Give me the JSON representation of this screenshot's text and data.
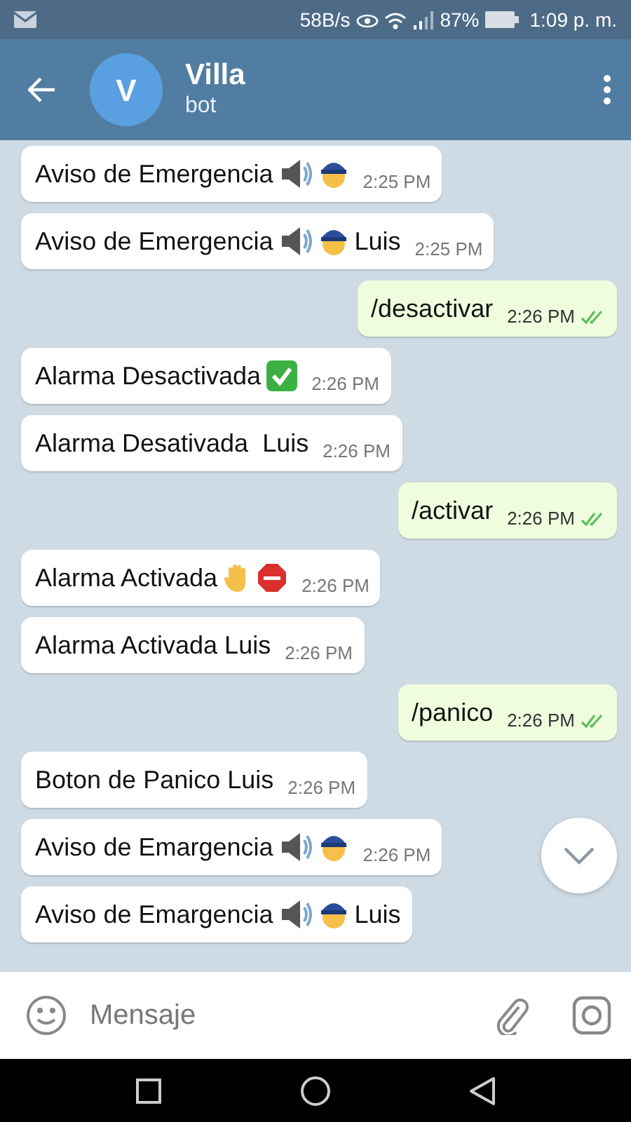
{
  "status_bar": {
    "speed": "58B/s",
    "battery": "87%",
    "time": "1:09 p. m."
  },
  "header": {
    "avatar": "V",
    "title": "Villa",
    "subtitle": "bot"
  },
  "messages": [
    {
      "outgoing": false,
      "time": "2:25 PM",
      "parts": [
        {
          "kind": "text",
          "text": "Aviso de Emergencia"
        },
        {
          "kind": "speaker"
        },
        {
          "kind": "officer"
        }
      ]
    },
    {
      "outgoing": false,
      "time": "2:25 PM",
      "parts": [
        {
          "kind": "text",
          "text": "Aviso de Emergencia"
        },
        {
          "kind": "speaker"
        },
        {
          "kind": "officer"
        },
        {
          "kind": "text",
          "text": "Luis"
        }
      ]
    },
    {
      "outgoing": true,
      "read": true,
      "time": "2:26 PM",
      "parts": [
        {
          "kind": "text",
          "text": "/desactivar"
        }
      ]
    },
    {
      "outgoing": false,
      "time": "2:26 PM",
      "parts": [
        {
          "kind": "text",
          "text": "Alarma Desactivada"
        },
        {
          "kind": "check"
        }
      ]
    },
    {
      "outgoing": false,
      "time": "2:26 PM",
      "parts": [
        {
          "kind": "text",
          "text": "Alarma Desativada  Luis"
        }
      ]
    },
    {
      "outgoing": true,
      "read": true,
      "time": "2:26 PM",
      "parts": [
        {
          "kind": "text",
          "text": "/activar"
        }
      ]
    },
    {
      "outgoing": false,
      "time": "2:26 PM",
      "parts": [
        {
          "kind": "text",
          "text": "Alarma Activada"
        },
        {
          "kind": "hand"
        },
        {
          "kind": "stop"
        }
      ]
    },
    {
      "outgoing": false,
      "time": "2:26 PM",
      "parts": [
        {
          "kind": "text",
          "text": "Alarma Activada Luis"
        }
      ]
    },
    {
      "outgoing": true,
      "read": true,
      "time": "2:26 PM",
      "parts": [
        {
          "kind": "text",
          "text": "/panico"
        }
      ]
    },
    {
      "outgoing": false,
      "time": "2:26 PM",
      "parts": [
        {
          "kind": "text",
          "text": "Boton de Panico Luis"
        }
      ]
    },
    {
      "outgoing": false,
      "time": "2:26 PM",
      "parts": [
        {
          "kind": "text",
          "text": "Aviso de Emargencia"
        },
        {
          "kind": "speaker"
        },
        {
          "kind": "officer"
        }
      ]
    },
    {
      "outgoing": false,
      "parts": [
        {
          "kind": "text",
          "text": "Aviso de Emargencia"
        },
        {
          "kind": "speaker"
        },
        {
          "kind": "officer"
        },
        {
          "kind": "text",
          "text": "Luis"
        }
      ]
    }
  ],
  "composer": {
    "placeholder": "Mensaje"
  }
}
